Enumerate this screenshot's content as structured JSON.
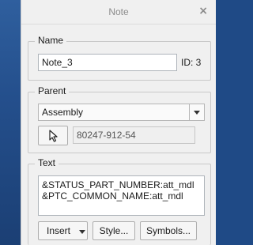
{
  "window": {
    "title": "Note",
    "close_glyph": "×"
  },
  "name_group": {
    "legend": "Name",
    "name_value": "Note_3",
    "id_label": "ID: 3"
  },
  "parent_group": {
    "legend": "Parent",
    "type_selected": "Assembly",
    "select_icon": "cursor-arrow-icon",
    "parent_value": "80247-912-54"
  },
  "text_group": {
    "legend": "Text",
    "lines": [
      "&STATUS_PART_NUMBER:att_mdl",
      "&PTC_COMMON_NAME:att_mdl"
    ]
  },
  "buttons": {
    "insert": "Insert",
    "style": "Style...",
    "symbols": "Symbols..."
  }
}
